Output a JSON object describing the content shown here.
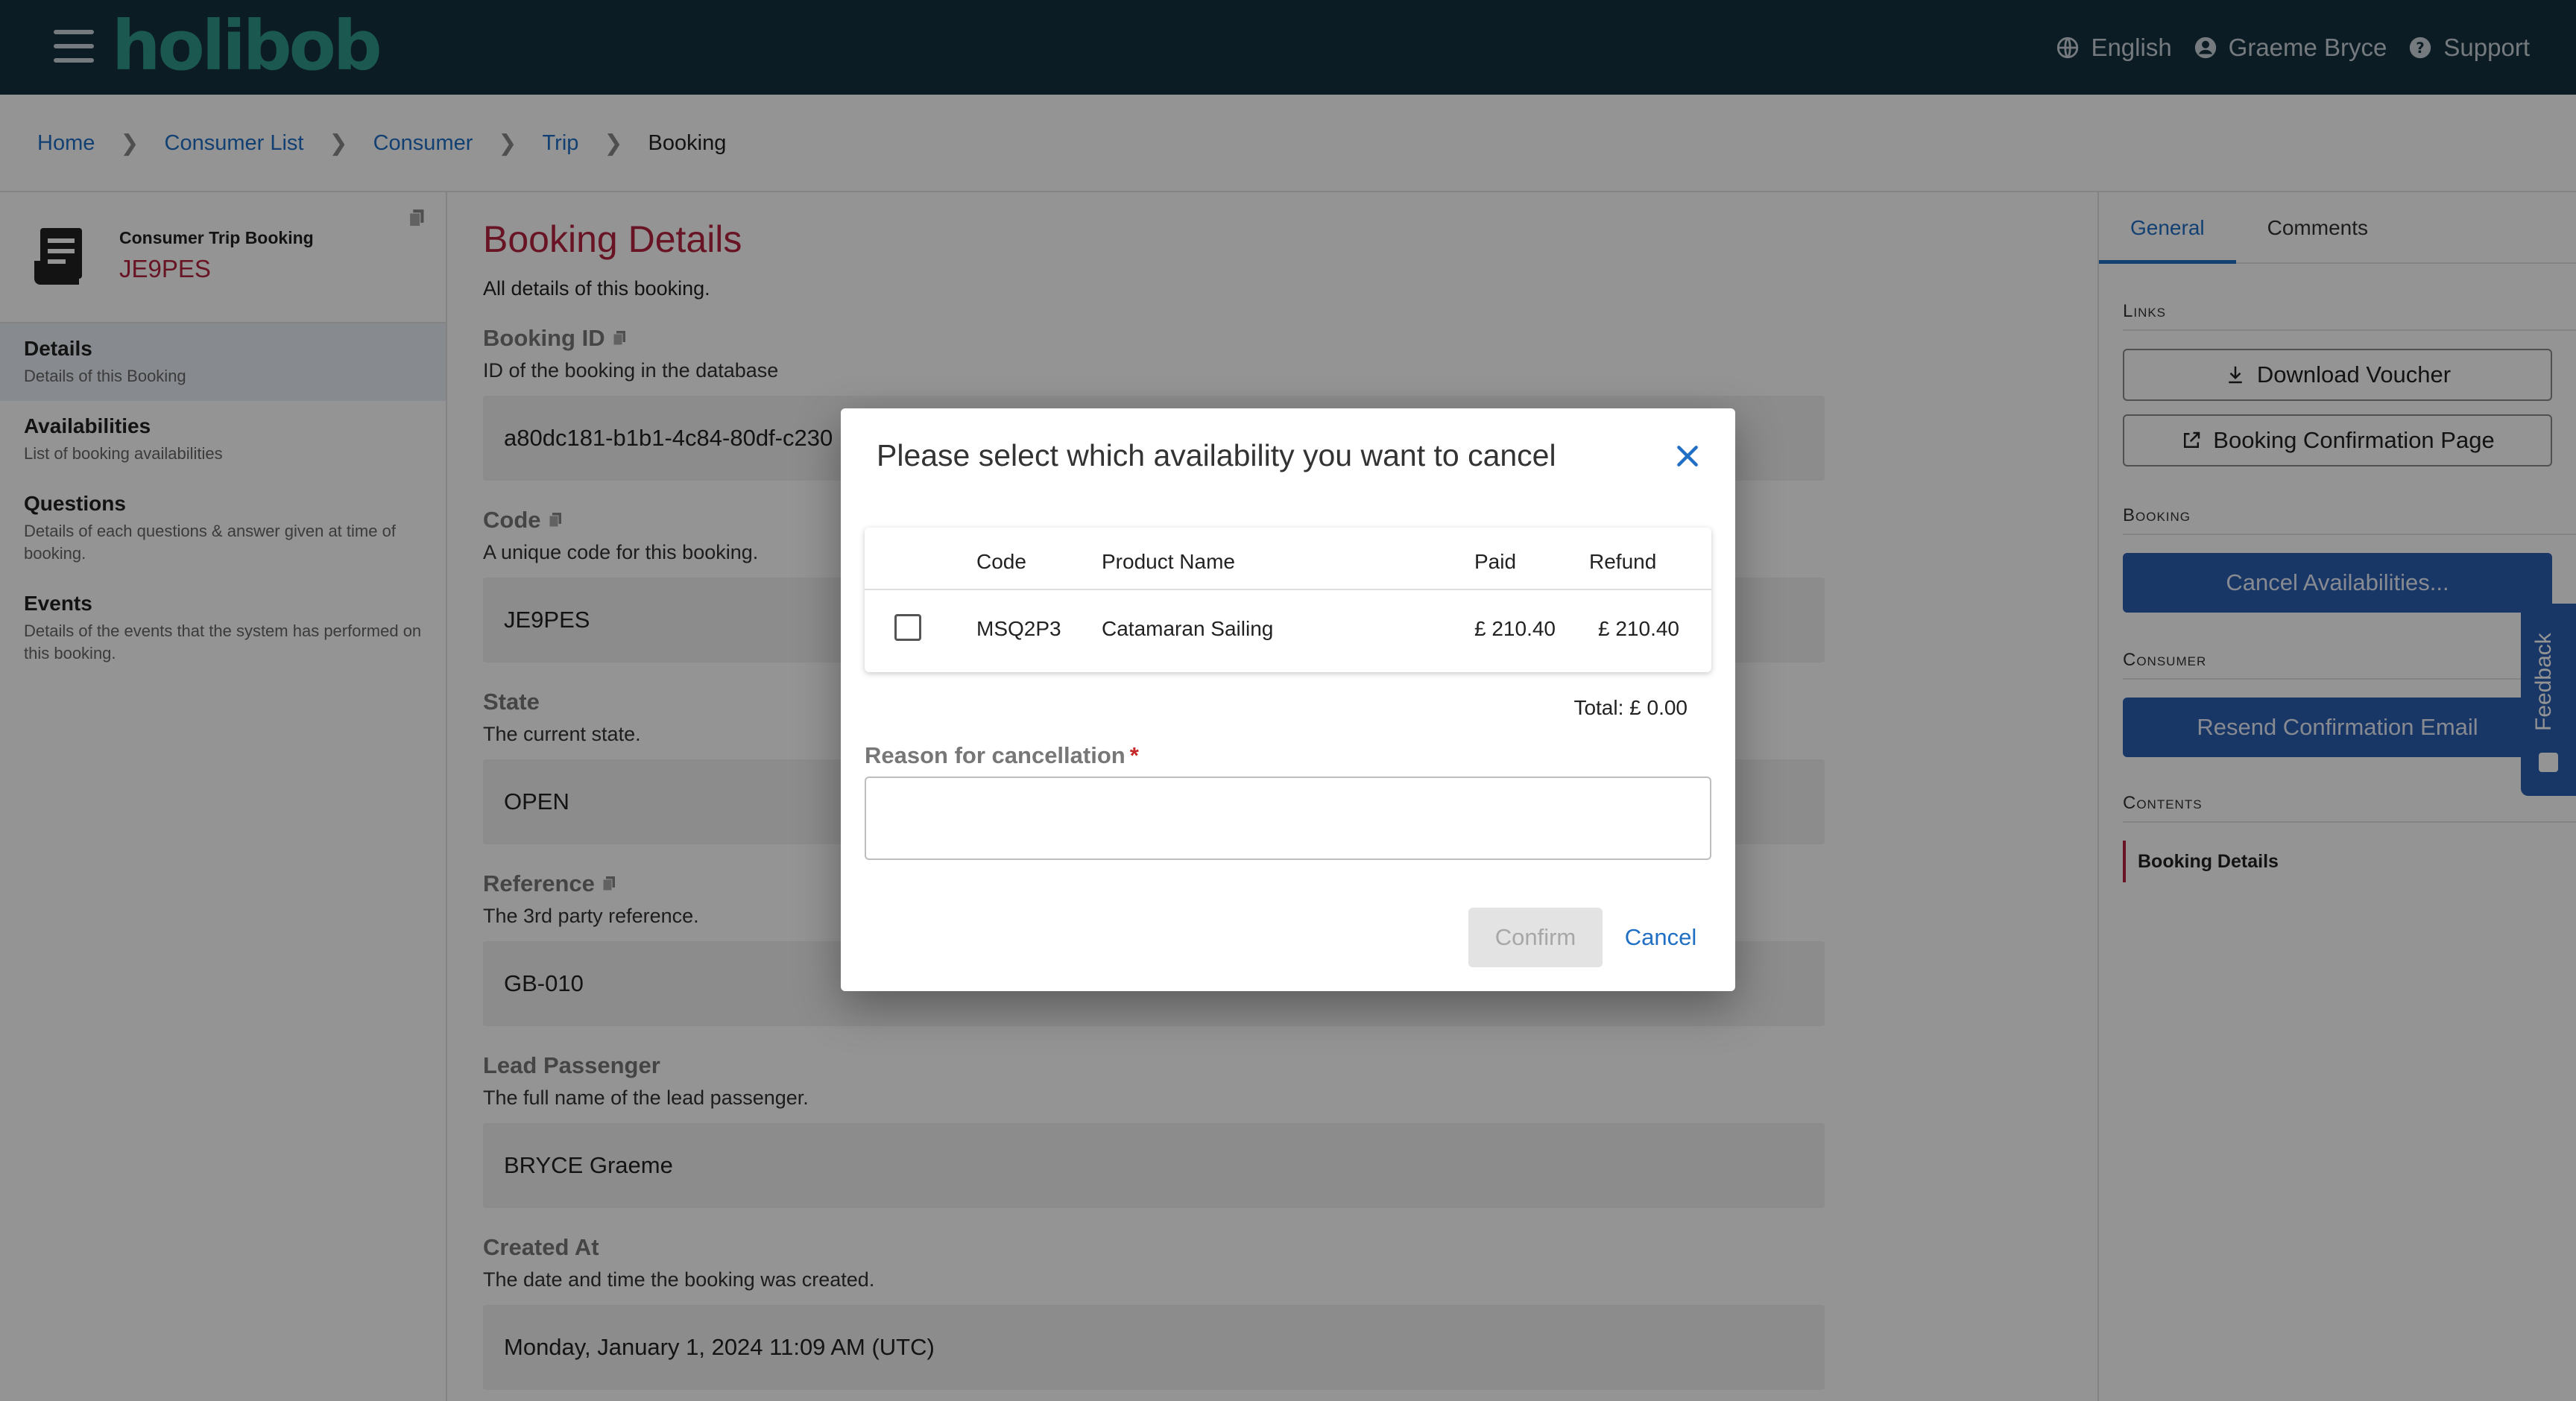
{
  "header": {
    "logo": "holibob",
    "language": "English",
    "user": "Graeme Bryce",
    "support": "Support"
  },
  "breadcrumb": [
    "Home",
    "Consumer List",
    "Consumer",
    "Trip",
    "Booking"
  ],
  "sidebar": {
    "kind": "Consumer Trip Booking",
    "code": "JE9PES",
    "items": [
      {
        "title": "Details",
        "desc": "Details of this Booking"
      },
      {
        "title": "Availabilities",
        "desc": "List of booking availabilities"
      },
      {
        "title": "Questions",
        "desc": "Details of each questions & answer given at time of booking."
      },
      {
        "title": "Events",
        "desc": "Details of the events that the system has performed on this booking."
      }
    ]
  },
  "main": {
    "title": "Booking Details",
    "subtitle": "All details of this booking.",
    "fields": [
      {
        "label": "Booking ID",
        "desc": "ID of the booking in the database",
        "value": "a80dc181-b1b1-4c84-80df-c230"
      },
      {
        "label": "Code",
        "desc": "A unique code for this booking.",
        "value": "JE9PES"
      },
      {
        "label": "State",
        "desc": "The current state.",
        "value": "OPEN"
      },
      {
        "label": "Reference",
        "desc": "The 3rd party reference.",
        "value": "GB-010"
      },
      {
        "label": "Lead Passenger",
        "desc": "The full name of the lead passenger.",
        "value": "BRYCE Graeme"
      },
      {
        "label": "Created At",
        "desc": "The date and time the booking was created.",
        "value": "Monday, January 1, 2024 11:09 AM (UTC)"
      }
    ]
  },
  "right_panel": {
    "tabs": [
      "General",
      "Comments"
    ],
    "links_title": "Links",
    "download_voucher": "Download Voucher",
    "confirmation_page": "Booking Confirmation Page",
    "booking_title": "Booking",
    "cancel_availabilities": "Cancel Availabilities...",
    "consumer_title": "Consumer",
    "resend_email": "Resend Confirmation Email",
    "contents_title": "Contents",
    "contents_item": "Booking Details"
  },
  "feedback": "Feedback",
  "modal": {
    "title": "Please select which availability you want to cancel",
    "columns": [
      "Code",
      "Product Name",
      "Paid",
      "Refund"
    ],
    "rows": [
      {
        "code": "MSQ2P3",
        "product": "Catamaran Sailing",
        "paid": "£ 210.40",
        "refund": "£ 210.40"
      }
    ],
    "total": "Total: £ 0.00",
    "reason_label": "Reason for cancellation",
    "required_mark": "*",
    "reason_value": "",
    "confirm": "Confirm",
    "cancel": "Cancel"
  }
}
